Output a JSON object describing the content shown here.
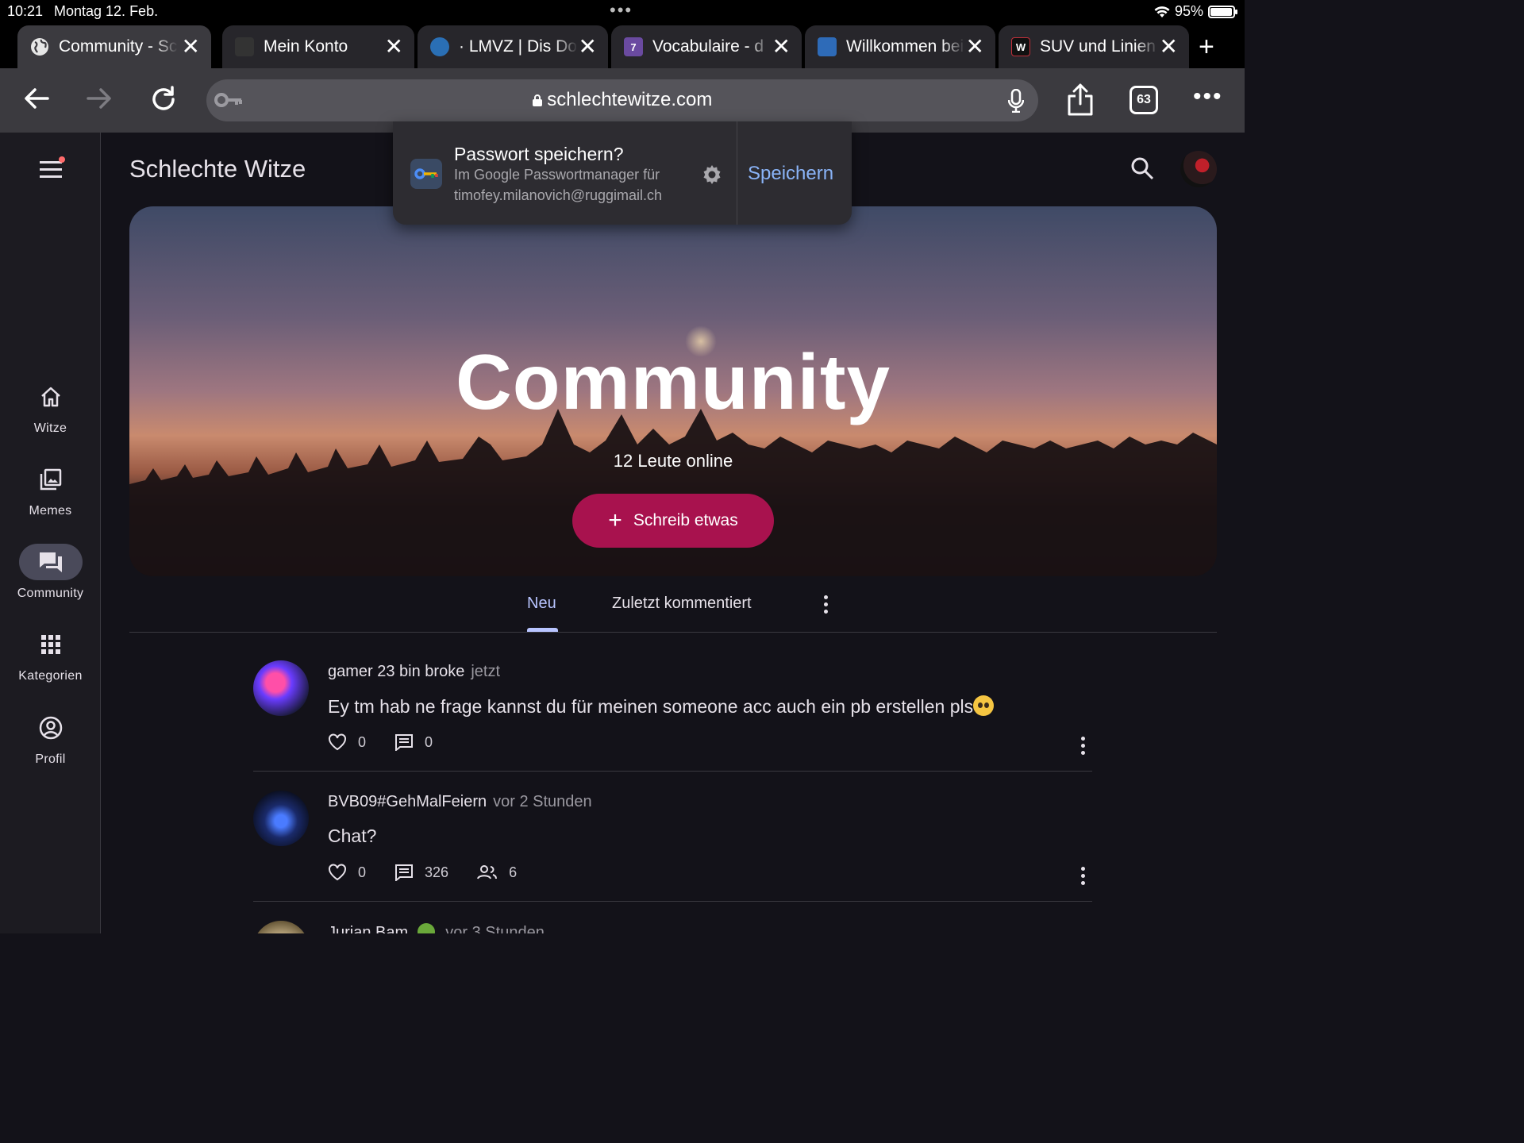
{
  "status": {
    "time": "10:21",
    "date": "Montag 12. Feb.",
    "battery": "95%"
  },
  "tabs": [
    {
      "title": "Community - Schlechte Witze",
      "active": true
    },
    {
      "title": "Mein Konto",
      "active": false
    },
    {
      "title": "· LMVZ | Dis Donc",
      "active": false
    },
    {
      "title": "Vocabulaire - d",
      "active": false
    },
    {
      "title": "Willkommen bei",
      "active": false
    },
    {
      "title": "SUV und Linien",
      "active": false
    }
  ],
  "toolbar": {
    "url": "schlechtewitze.com",
    "tab_count": "63"
  },
  "password_popup": {
    "title": "Passwort speichern?",
    "subtitle": "Im Google Passwortmanager für",
    "account": "timofey.milanovich@ruggimail.ch",
    "save_label": "Speichern"
  },
  "site": {
    "title": "Schlechte Witze"
  },
  "nav": [
    {
      "label": "Witze",
      "icon": "home-icon"
    },
    {
      "label": "Memes",
      "icon": "image-icon"
    },
    {
      "label": "Community",
      "icon": "forum-icon",
      "active": true
    },
    {
      "label": "Kategorien",
      "icon": "grid-icon"
    },
    {
      "label": "Profil",
      "icon": "account-icon"
    }
  ],
  "hero": {
    "title": "Community",
    "online": "12 Leute online",
    "write_label": "Schreib etwas"
  },
  "feed_tabs": [
    {
      "label": "Neu",
      "active": true
    },
    {
      "label": "Zuletzt kommentiert",
      "active": false
    }
  ],
  "posts": [
    {
      "author": "gamer 23 bin broke",
      "time": "jetzt",
      "text": "Ey tm hab ne frage kannst du für meinen someone acc auch ein pb erstellen pls",
      "likes": "0",
      "comments": "0"
    },
    {
      "author": "BVB09#GehMalFeiern",
      "time": "vor 2 Stunden",
      "text": "Chat?",
      "likes": "0",
      "comments": "326",
      "members": "6"
    },
    {
      "author": "Jurian Bam",
      "time": "vor 3 Stunden"
    }
  ],
  "colors": {
    "accent": "#a8124e",
    "link": "#8ab4f8",
    "tab_active": "#b8c4ff"
  }
}
